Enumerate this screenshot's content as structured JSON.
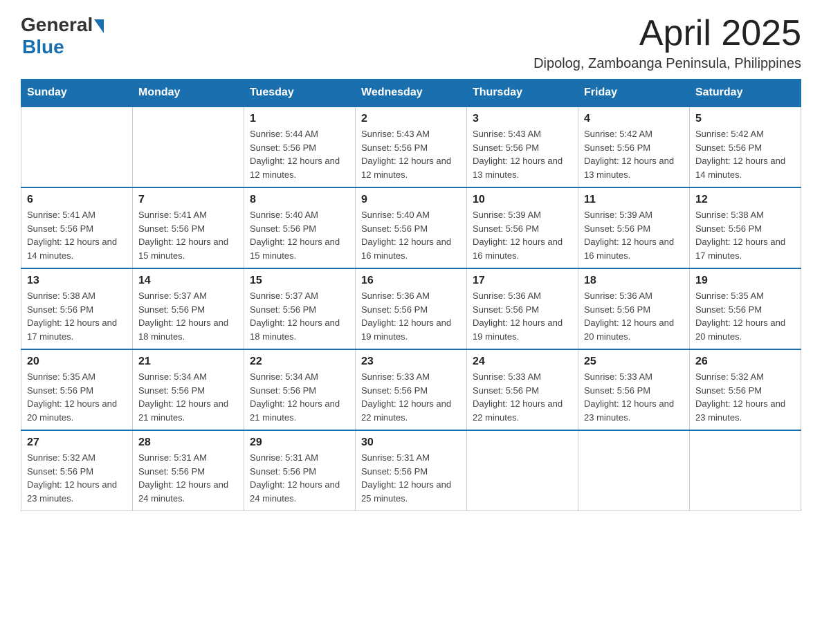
{
  "header": {
    "logo_general": "General",
    "logo_blue": "Blue",
    "month_title": "April 2025",
    "location": "Dipolog, Zamboanga Peninsula, Philippines"
  },
  "weekdays": [
    "Sunday",
    "Monday",
    "Tuesday",
    "Wednesday",
    "Thursday",
    "Friday",
    "Saturday"
  ],
  "weeks": [
    [
      {
        "day": "",
        "sunrise": "",
        "sunset": "",
        "daylight": ""
      },
      {
        "day": "",
        "sunrise": "",
        "sunset": "",
        "daylight": ""
      },
      {
        "day": "1",
        "sunrise": "Sunrise: 5:44 AM",
        "sunset": "Sunset: 5:56 PM",
        "daylight": "Daylight: 12 hours and 12 minutes."
      },
      {
        "day": "2",
        "sunrise": "Sunrise: 5:43 AM",
        "sunset": "Sunset: 5:56 PM",
        "daylight": "Daylight: 12 hours and 12 minutes."
      },
      {
        "day": "3",
        "sunrise": "Sunrise: 5:43 AM",
        "sunset": "Sunset: 5:56 PM",
        "daylight": "Daylight: 12 hours and 13 minutes."
      },
      {
        "day": "4",
        "sunrise": "Sunrise: 5:42 AM",
        "sunset": "Sunset: 5:56 PM",
        "daylight": "Daylight: 12 hours and 13 minutes."
      },
      {
        "day": "5",
        "sunrise": "Sunrise: 5:42 AM",
        "sunset": "Sunset: 5:56 PM",
        "daylight": "Daylight: 12 hours and 14 minutes."
      }
    ],
    [
      {
        "day": "6",
        "sunrise": "Sunrise: 5:41 AM",
        "sunset": "Sunset: 5:56 PM",
        "daylight": "Daylight: 12 hours and 14 minutes."
      },
      {
        "day": "7",
        "sunrise": "Sunrise: 5:41 AM",
        "sunset": "Sunset: 5:56 PM",
        "daylight": "Daylight: 12 hours and 15 minutes."
      },
      {
        "day": "8",
        "sunrise": "Sunrise: 5:40 AM",
        "sunset": "Sunset: 5:56 PM",
        "daylight": "Daylight: 12 hours and 15 minutes."
      },
      {
        "day": "9",
        "sunrise": "Sunrise: 5:40 AM",
        "sunset": "Sunset: 5:56 PM",
        "daylight": "Daylight: 12 hours and 16 minutes."
      },
      {
        "day": "10",
        "sunrise": "Sunrise: 5:39 AM",
        "sunset": "Sunset: 5:56 PM",
        "daylight": "Daylight: 12 hours and 16 minutes."
      },
      {
        "day": "11",
        "sunrise": "Sunrise: 5:39 AM",
        "sunset": "Sunset: 5:56 PM",
        "daylight": "Daylight: 12 hours and 16 minutes."
      },
      {
        "day": "12",
        "sunrise": "Sunrise: 5:38 AM",
        "sunset": "Sunset: 5:56 PM",
        "daylight": "Daylight: 12 hours and 17 minutes."
      }
    ],
    [
      {
        "day": "13",
        "sunrise": "Sunrise: 5:38 AM",
        "sunset": "Sunset: 5:56 PM",
        "daylight": "Daylight: 12 hours and 17 minutes."
      },
      {
        "day": "14",
        "sunrise": "Sunrise: 5:37 AM",
        "sunset": "Sunset: 5:56 PM",
        "daylight": "Daylight: 12 hours and 18 minutes."
      },
      {
        "day": "15",
        "sunrise": "Sunrise: 5:37 AM",
        "sunset": "Sunset: 5:56 PM",
        "daylight": "Daylight: 12 hours and 18 minutes."
      },
      {
        "day": "16",
        "sunrise": "Sunrise: 5:36 AM",
        "sunset": "Sunset: 5:56 PM",
        "daylight": "Daylight: 12 hours and 19 minutes."
      },
      {
        "day": "17",
        "sunrise": "Sunrise: 5:36 AM",
        "sunset": "Sunset: 5:56 PM",
        "daylight": "Daylight: 12 hours and 19 minutes."
      },
      {
        "day": "18",
        "sunrise": "Sunrise: 5:36 AM",
        "sunset": "Sunset: 5:56 PM",
        "daylight": "Daylight: 12 hours and 20 minutes."
      },
      {
        "day": "19",
        "sunrise": "Sunrise: 5:35 AM",
        "sunset": "Sunset: 5:56 PM",
        "daylight": "Daylight: 12 hours and 20 minutes."
      }
    ],
    [
      {
        "day": "20",
        "sunrise": "Sunrise: 5:35 AM",
        "sunset": "Sunset: 5:56 PM",
        "daylight": "Daylight: 12 hours and 20 minutes."
      },
      {
        "day": "21",
        "sunrise": "Sunrise: 5:34 AM",
        "sunset": "Sunset: 5:56 PM",
        "daylight": "Daylight: 12 hours and 21 minutes."
      },
      {
        "day": "22",
        "sunrise": "Sunrise: 5:34 AM",
        "sunset": "Sunset: 5:56 PM",
        "daylight": "Daylight: 12 hours and 21 minutes."
      },
      {
        "day": "23",
        "sunrise": "Sunrise: 5:33 AM",
        "sunset": "Sunset: 5:56 PM",
        "daylight": "Daylight: 12 hours and 22 minutes."
      },
      {
        "day": "24",
        "sunrise": "Sunrise: 5:33 AM",
        "sunset": "Sunset: 5:56 PM",
        "daylight": "Daylight: 12 hours and 22 minutes."
      },
      {
        "day": "25",
        "sunrise": "Sunrise: 5:33 AM",
        "sunset": "Sunset: 5:56 PM",
        "daylight": "Daylight: 12 hours and 23 minutes."
      },
      {
        "day": "26",
        "sunrise": "Sunrise: 5:32 AM",
        "sunset": "Sunset: 5:56 PM",
        "daylight": "Daylight: 12 hours and 23 minutes."
      }
    ],
    [
      {
        "day": "27",
        "sunrise": "Sunrise: 5:32 AM",
        "sunset": "Sunset: 5:56 PM",
        "daylight": "Daylight: 12 hours and 23 minutes."
      },
      {
        "day": "28",
        "sunrise": "Sunrise: 5:31 AM",
        "sunset": "Sunset: 5:56 PM",
        "daylight": "Daylight: 12 hours and 24 minutes."
      },
      {
        "day": "29",
        "sunrise": "Sunrise: 5:31 AM",
        "sunset": "Sunset: 5:56 PM",
        "daylight": "Daylight: 12 hours and 24 minutes."
      },
      {
        "day": "30",
        "sunrise": "Sunrise: 5:31 AM",
        "sunset": "Sunset: 5:56 PM",
        "daylight": "Daylight: 12 hours and 25 minutes."
      },
      {
        "day": "",
        "sunrise": "",
        "sunset": "",
        "daylight": ""
      },
      {
        "day": "",
        "sunrise": "",
        "sunset": "",
        "daylight": ""
      },
      {
        "day": "",
        "sunrise": "",
        "sunset": "",
        "daylight": ""
      }
    ]
  ]
}
